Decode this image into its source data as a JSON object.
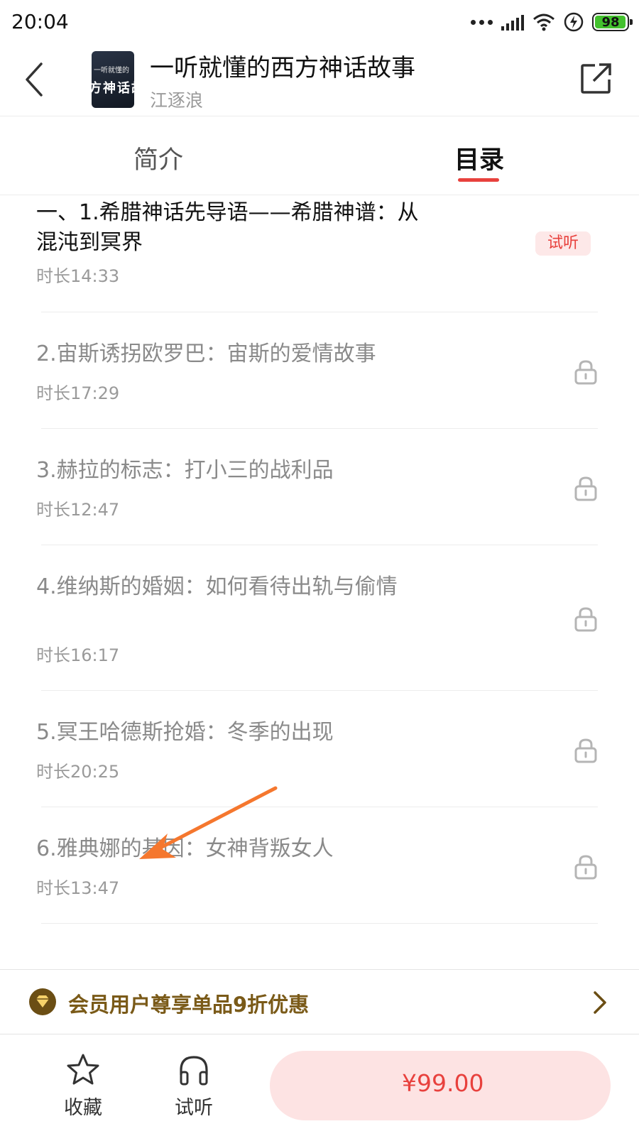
{
  "status_bar": {
    "time": "20:04",
    "battery": "98",
    "icons": [
      "more-dots-icon",
      "signal-icon",
      "wifi-icon",
      "charging-icon",
      "battery-icon"
    ]
  },
  "header": {
    "title": "一听就懂的西方神话故事",
    "author": "江逐浪",
    "cover_small_text": "一听就懂的",
    "cover_big_text": "方神话故"
  },
  "tabs": [
    {
      "label": "简介",
      "active": false
    },
    {
      "label": "目录",
      "active": true
    }
  ],
  "episodes": [
    {
      "title": "一、1.希腊神话先导语——希腊神谱：从混沌到冥界",
      "duration": "时长14:33",
      "badge": "试听",
      "locked": false
    },
    {
      "title": "2.宙斯诱拐欧罗巴：宙斯的爱情故事",
      "duration": "时长17:29",
      "locked": true
    },
    {
      "title": "3.赫拉的标志：打小三的战利品",
      "duration": "时长12:47",
      "locked": true
    },
    {
      "title": "4.维纳斯的婚姻：如何看待出轨与偷情",
      "duration": "时长16:17",
      "locked": true
    },
    {
      "title": "5.冥王哈德斯抢婚：冬季的出现",
      "duration": "时长20:25",
      "locked": true
    },
    {
      "title": "6.雅典娜的基因：女神背叛女人",
      "duration": "时长13:47",
      "locked": true
    }
  ],
  "promo": {
    "text": "会员用户尊享单品9折优惠"
  },
  "bottom_bar": {
    "favorite_label": "收藏",
    "trial_label": "试听",
    "price": "¥99.00"
  },
  "colors": {
    "accent_red": "#e8413d",
    "badge_bg": "#fde8e8",
    "promo_gold": "#7a5a18",
    "annotation_arrow": "#f5772e"
  }
}
